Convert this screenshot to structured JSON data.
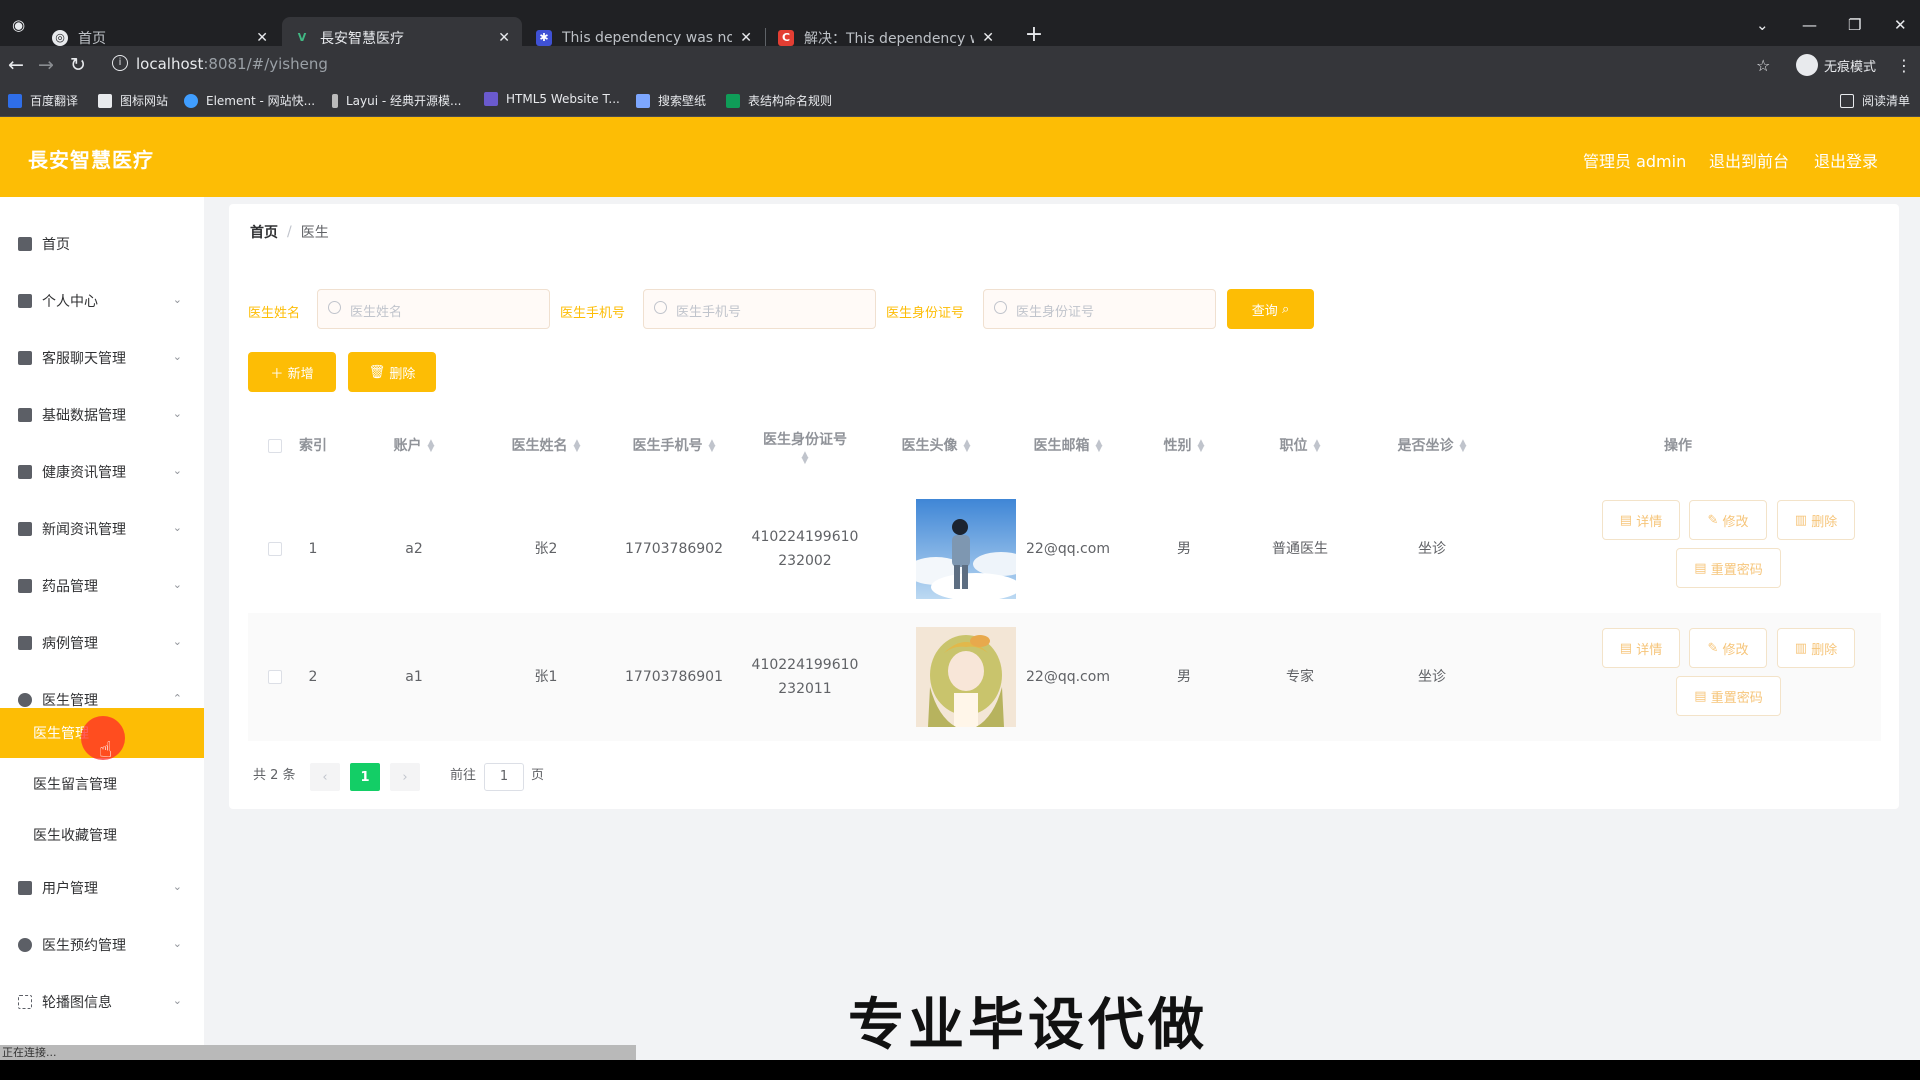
{
  "browser": {
    "tabs": [
      {
        "title": "首页",
        "icon": "globe-icon"
      },
      {
        "title": "長安智慧医疗",
        "icon": "vue-icon"
      },
      {
        "title": "This dependency was not foun",
        "icon": "baidu-icon"
      },
      {
        "title": "解决：This dependency was no",
        "icon": "csdn-icon"
      }
    ],
    "url_host": "localhost",
    "url_path": ":8081/#/yisheng",
    "incognito_label": "无痕模式",
    "bookmarks": [
      "百度翻译",
      "图标网站",
      "Element - 网站快...",
      "Layui - 经典开源模...",
      "HTML5 Website T...",
      "搜索壁纸",
      "表结构命名规则"
    ],
    "reading_list": "阅读清单"
  },
  "header": {
    "brand": "長安智慧医疗",
    "admin_label": "管理员 admin",
    "to_front": "退出到前台",
    "logout": "退出登录"
  },
  "sidebar": {
    "items": [
      {
        "label": "首页",
        "icon": "home-icon"
      },
      {
        "label": "个人中心",
        "icon": "user-icon"
      },
      {
        "label": "客服聊天管理",
        "icon": "chat-icon"
      },
      {
        "label": "基础数据管理",
        "icon": "send-icon"
      },
      {
        "label": "健康资讯管理",
        "icon": "microphone-icon"
      },
      {
        "label": "新闻资讯管理",
        "icon": "news-icon"
      },
      {
        "label": "药品管理",
        "icon": "medicine-icon"
      },
      {
        "label": "病例管理",
        "icon": "case-icon"
      },
      {
        "label": "医生管理",
        "icon": "doctor-icon"
      },
      {
        "label": "用户管理",
        "icon": "users-icon"
      },
      {
        "label": "医生预约管理",
        "icon": "clock-icon"
      },
      {
        "label": "轮播图信息",
        "icon": "image-icon"
      }
    ],
    "sub_items": [
      "医生管理",
      "医生留言管理",
      "医生收藏管理"
    ]
  },
  "breadcrumb": {
    "home": "首页",
    "sep": "/",
    "current": "医生"
  },
  "search": {
    "name_label": "医生姓名",
    "name_placeholder": "医生姓名",
    "phone_label": "医生手机号",
    "phone_placeholder": "医生手机号",
    "id_label": "医生身份证号",
    "id_placeholder": "医生身份证号",
    "query_button": "查询"
  },
  "actions": {
    "add": "新增",
    "delete": "删除"
  },
  "table": {
    "headers": [
      "索引",
      "账户",
      "医生姓名",
      "医生手机号",
      "医生身份证号",
      "医生头像",
      "医生邮箱",
      "性别",
      "职位",
      "是否坐诊",
      "操作"
    ],
    "rows": [
      {
        "index": "1",
        "account": "a2",
        "name": "张2",
        "phone": "17703786902",
        "id_line1": "410224199610",
        "id_line2": "232002",
        "email": "22@qq.com",
        "gender": "男",
        "position": "普通医生",
        "onsite": "坐诊"
      },
      {
        "index": "2",
        "account": "a1",
        "name": "张1",
        "phone": "17703786901",
        "id_line1": "410224199610",
        "id_line2": "232011",
        "email": "22@qq.com",
        "gender": "男",
        "position": "专家",
        "onsite": "坐诊"
      }
    ],
    "ops": {
      "detail": "详情",
      "edit": "修改",
      "delete": "删除",
      "reset": "重置密码"
    }
  },
  "pager": {
    "total": "共 2 条",
    "current_page": "1",
    "goto_prefix": "前往",
    "goto_value": "1",
    "goto_suffix": "页"
  },
  "overlay": {
    "watermark": "专业毕设代做",
    "status": "正在连接..."
  },
  "colors": {
    "accent": "#fdbd05",
    "active_page": "#13ce66"
  }
}
